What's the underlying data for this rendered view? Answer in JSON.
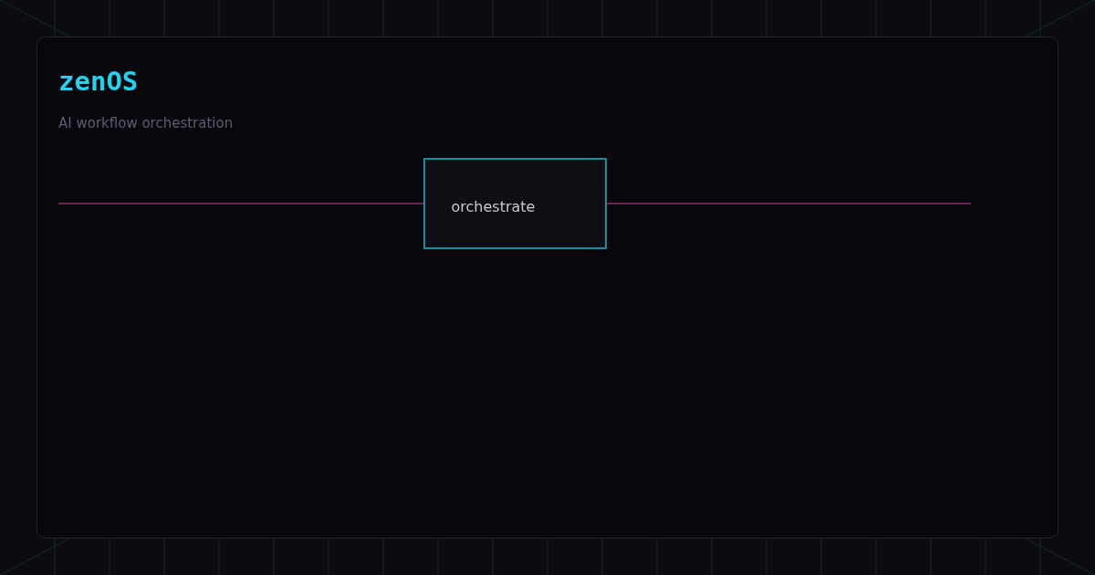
{
  "app": {
    "title": "zenOS",
    "subtitle": "AI workflow orchestration"
  },
  "workflow": {
    "nodes": [
      {
        "label": "orchestrate"
      }
    ]
  }
}
